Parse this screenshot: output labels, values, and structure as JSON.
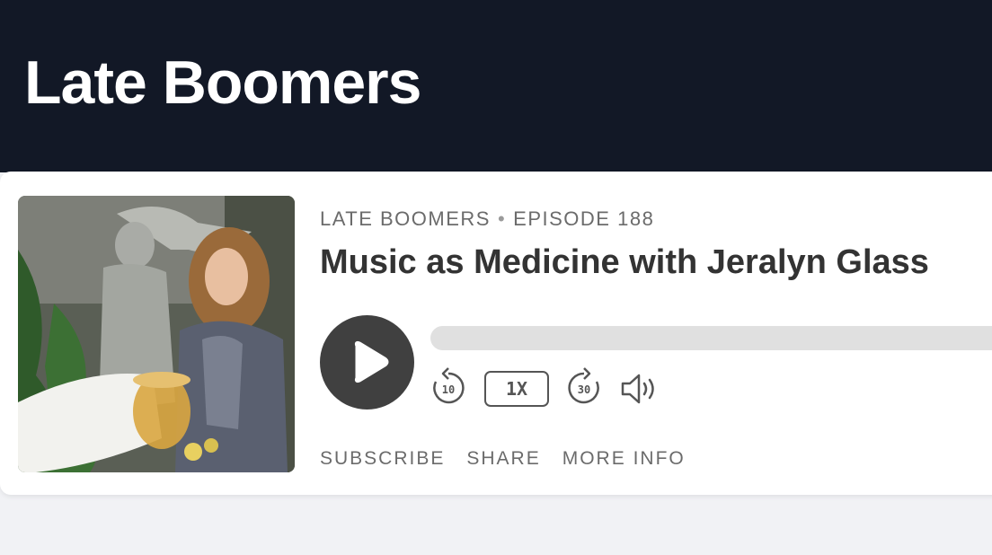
{
  "header": {
    "title": "Late Boomers"
  },
  "episode": {
    "show_name": "LATE BOOMERS",
    "separator": "•",
    "episode_label": "EPISODE 188",
    "title": "Music as Medicine with Jeralyn Glass",
    "progress_fraction": 0
  },
  "controls": {
    "rewind_seconds": "10",
    "speed": "1X",
    "forward_seconds": "30"
  },
  "links": {
    "subscribe": "SUBSCRIBE",
    "share": "SHARE",
    "more_info": "MORE INFO"
  },
  "colors": {
    "header_bg": "#121826",
    "page_bg": "#f1f2f5",
    "control_dark": "#404040",
    "track": "#e0e0e0"
  },
  "icons": {
    "play": "play-icon",
    "rewind": "rewind-10-icon",
    "forward": "forward-30-icon",
    "volume": "volume-icon"
  }
}
